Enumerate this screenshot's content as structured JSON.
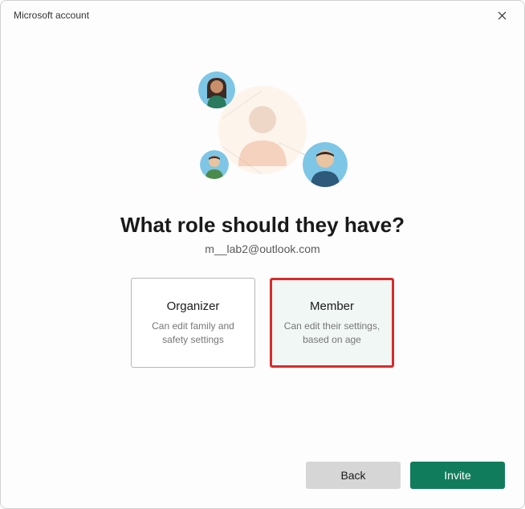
{
  "window": {
    "title": "Microsoft account"
  },
  "heading": "What role should they have?",
  "email": "m__lab2@outlook.com",
  "roles": {
    "organizer": {
      "title": "Organizer",
      "desc": "Can edit family and safety settings"
    },
    "member": {
      "title": "Member",
      "desc": "Can edit their settings, based on age"
    }
  },
  "buttons": {
    "back": "Back",
    "invite": "Invite"
  },
  "colors": {
    "accent": "#107c5b",
    "highlight": "#d92b2b"
  }
}
